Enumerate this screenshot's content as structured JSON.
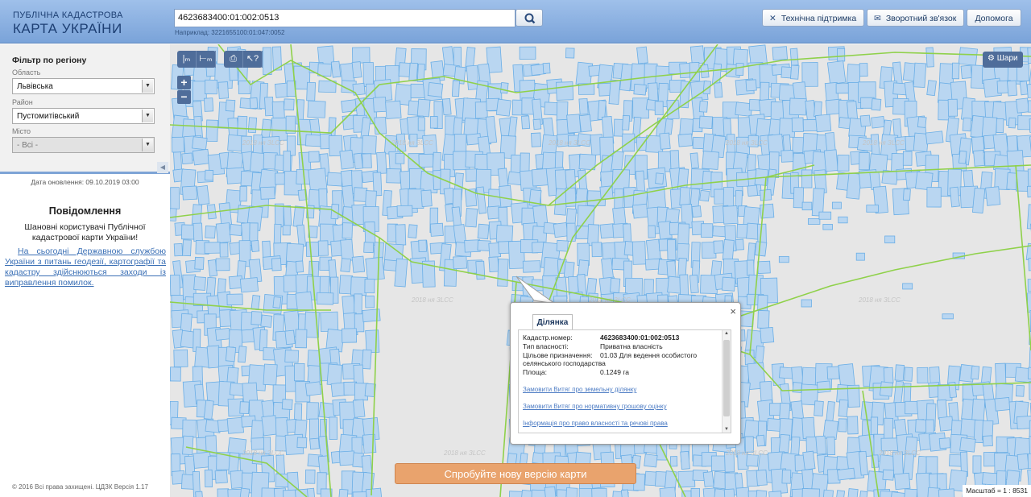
{
  "header": {
    "logo_line1": "ПУБЛІЧНА КАДАСТРОВА",
    "logo_line2": "КАРТА УКРАЇНИ",
    "search_value": "4623683400:01:002:0513",
    "search_hint": "Наприклад: 3221655100:01:047:0052",
    "support_label": "Технічна підтримка",
    "feedback_label": "Зворотний зв'язок",
    "help_label": "Допомога"
  },
  "sidebar": {
    "filter_title": "Фільтр по регіону",
    "region_label": "Область",
    "region_value": "Львівська",
    "district_label": "Район",
    "district_value": "Пустомитівський",
    "city_label": "Місто",
    "city_value": "- Всі -",
    "update_date": "Дата оновлення: 09.10.2019 03:00",
    "notice_title": "Повідомлення",
    "notice_greeting": "Шановні користувачі Публічної кадастрової карти України!",
    "notice_body": "На сьогодні Державною службою України з питань геодезії, картографії та кадастру здійснюються заходи із виправлення помилок.",
    "copyright": "© 2016 Всі права захищені. ЦДЗК Версія 1.17"
  },
  "map": {
    "layers_label": "Шари",
    "new_version_label": "Спробуйте нову версію карти",
    "scale_text": "Масштаб = 1 : 8531",
    "watermark": "2018 ня ЗLCC",
    "colors": {
      "parcel_fill": "#b9d6f1",
      "parcel_stroke": "#6aaee6",
      "boundary": "#8fd14a",
      "background": "#e6e6e6"
    }
  },
  "popup": {
    "tab_label": "Ділянка",
    "rows": [
      {
        "label": "Кадастр.номер:",
        "value": "4623683400:01:002:0513"
      },
      {
        "label": "Тип власності:",
        "value": "Приватна власність"
      },
      {
        "label": "Цільове призначення:",
        "value": "01.03 Для ведення особистого"
      },
      {
        "label": "селянського господарства",
        "value": ""
      },
      {
        "label": "Площа:",
        "value": "0.1249 га"
      }
    ],
    "links": [
      "Замовити Витяг про земельну ділянку",
      "Замовити Витяг про нормативну грошову оцінку",
      "Інформація про право власності та речові права"
    ]
  }
}
